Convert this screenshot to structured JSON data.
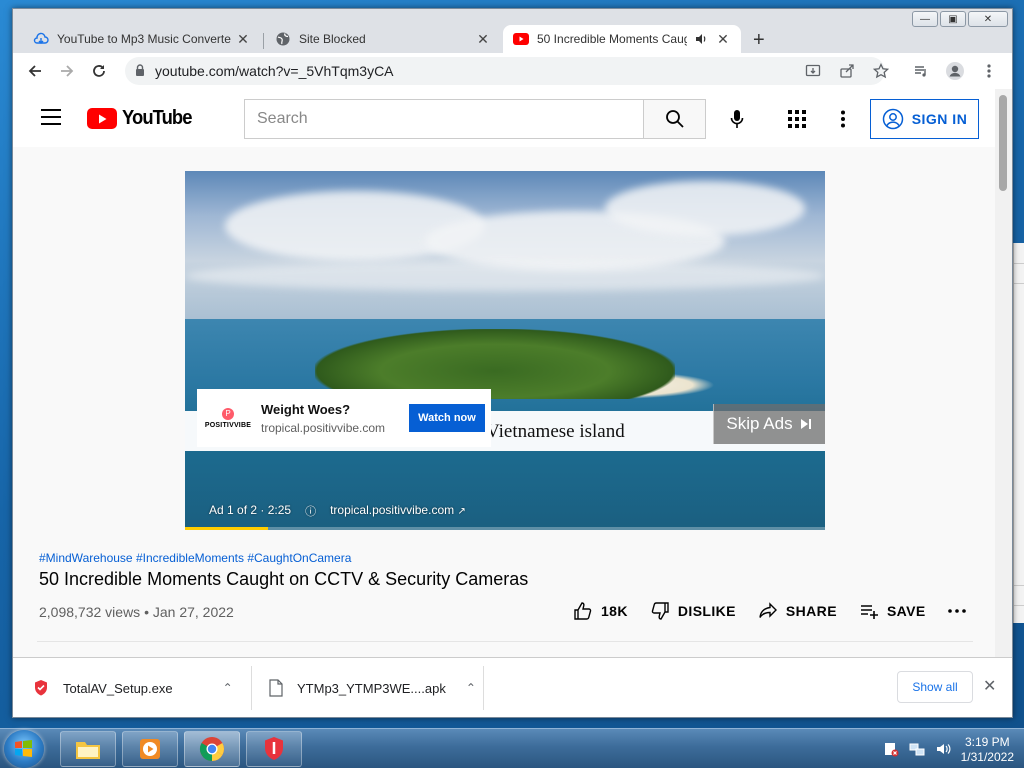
{
  "browser": {
    "tabs": [
      {
        "title": "YouTube to Mp3 Music Converte",
        "icon": "cloud-download-icon",
        "active": false
      },
      {
        "title": "Site Blocked",
        "icon": "globe-icon",
        "active": false
      },
      {
        "title": "50 Incredible Moments Caug",
        "icon": "youtube-icon",
        "active": true,
        "audio": true
      }
    ],
    "url": "youtube.com/watch?v=_5VhTqm3yCA"
  },
  "youtube": {
    "logo_text": "YouTube",
    "search_placeholder": "Search",
    "sign_in": "SIGN IN"
  },
  "ad": {
    "headline": "Weight Woes?",
    "url": "tropical.positivvibe.com",
    "brand": "POSITIVVIBE",
    "cta": "Watch now",
    "skip": "Skip Ads",
    "counter": "Ad 1 of 2 · 2:25",
    "meta_url": "tropical.positivvibe.com",
    "progress": 0.13
  },
  "video": {
    "lower_third": "Island in a remote Vietnamese island",
    "hashtags": "#MindWarehouse #IncredibleMoments #CaughtOnCamera",
    "title": "50 Incredible Moments Caught on CCTV & Security Cameras",
    "stats": "2,098,732 views • Jan 27, 2022",
    "likes": "18K",
    "dislike": "DISLIKE",
    "share": "SHARE",
    "save": "SAVE"
  },
  "downloads": {
    "items": [
      {
        "name": "TotalAV_Setup.exe",
        "icon": "shield-icon"
      },
      {
        "name": "YTMp3_YTMP3WE....apk",
        "icon": "file-icon"
      }
    ],
    "show_all": "Show all"
  },
  "taskbar": {
    "time": "3:19 PM",
    "date": "1/31/2022"
  },
  "colors": {
    "youtube_red": "#ff0000",
    "link_blue": "#065fd4",
    "chrome_tab_bg": "#dee1e6"
  }
}
